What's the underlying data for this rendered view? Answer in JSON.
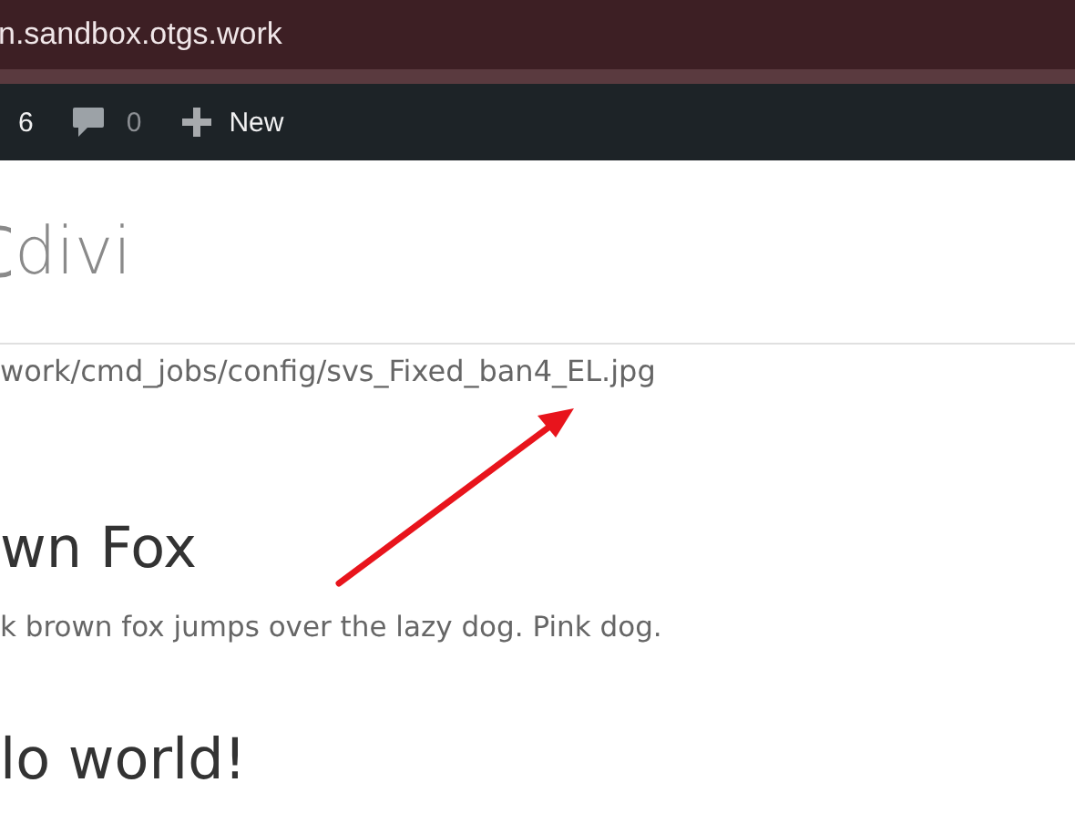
{
  "browser": {
    "address": "n.sandbox.otgs.work"
  },
  "admin_bar": {
    "updates_count": "6",
    "comments_count": "0",
    "new_label": "New"
  },
  "site": {
    "logo_text": "divi"
  },
  "page": {
    "file_path": "work/cmd_jobs/config/svs_Fixed_ban4_EL.jpg",
    "posts": [
      {
        "title": "wn Fox",
        "excerpt": "k brown fox jumps over the lazy dog. Pink dog."
      },
      {
        "title": "lo world!"
      }
    ]
  }
}
